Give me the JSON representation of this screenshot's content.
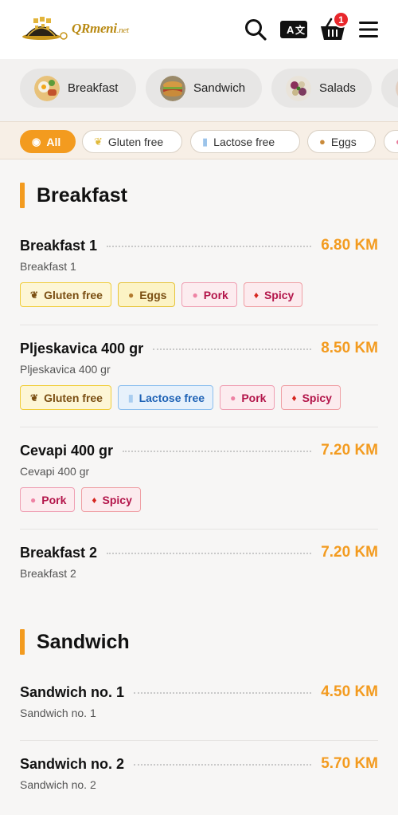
{
  "header": {
    "logo_text": "QRmeni",
    "logo_suffix": ".net",
    "cart_count": "1",
    "icons": [
      "search-icon",
      "translate-icon",
      "cart-icon",
      "menu-icon"
    ]
  },
  "categories": [
    {
      "label": "Breakfast",
      "icon": "breakfast-thumb"
    },
    {
      "label": "Sandwich",
      "icon": "sandwich-thumb"
    },
    {
      "label": "Salads",
      "icon": "salads-thumb"
    }
  ],
  "filters": [
    {
      "label": "All",
      "active": true
    },
    {
      "label": "Gluten free",
      "active": false
    },
    {
      "label": "Lactose free",
      "active": false
    },
    {
      "label": "Eggs",
      "active": false
    }
  ],
  "sections": [
    {
      "title": "Breakfast",
      "items": [
        {
          "name": "Breakfast 1",
          "price": "6.80 KM",
          "desc": "Breakfast 1",
          "tags": [
            "Gluten free",
            "Eggs",
            "Pork",
            "Spicy"
          ]
        },
        {
          "name": "Pljeskavica 400 gr",
          "price": "8.50 KM",
          "desc": "Pljeskavica 400 gr",
          "tags": [
            "Gluten free",
            "Lactose free",
            "Pork",
            "Spicy"
          ]
        },
        {
          "name": "Cevapi 400 gr",
          "price": "7.20 KM",
          "desc": "Cevapi 400 gr",
          "tags": [
            "Pork",
            "Spicy"
          ]
        },
        {
          "name": "Breakfast 2",
          "price": "7.20 KM",
          "desc": "Breakfast 2",
          "tags": []
        }
      ]
    },
    {
      "title": "Sandwich",
      "items": [
        {
          "name": "Sandwich no. 1",
          "price": "4.50 KM",
          "desc": "Sandwich no. 1",
          "tags": []
        },
        {
          "name": "Sandwich no. 2",
          "price": "5.70 KM",
          "desc": "Sandwich no. 2",
          "tags": []
        }
      ]
    }
  ],
  "colors": {
    "accent": "#f39b1f",
    "badge": "#e8272c"
  }
}
